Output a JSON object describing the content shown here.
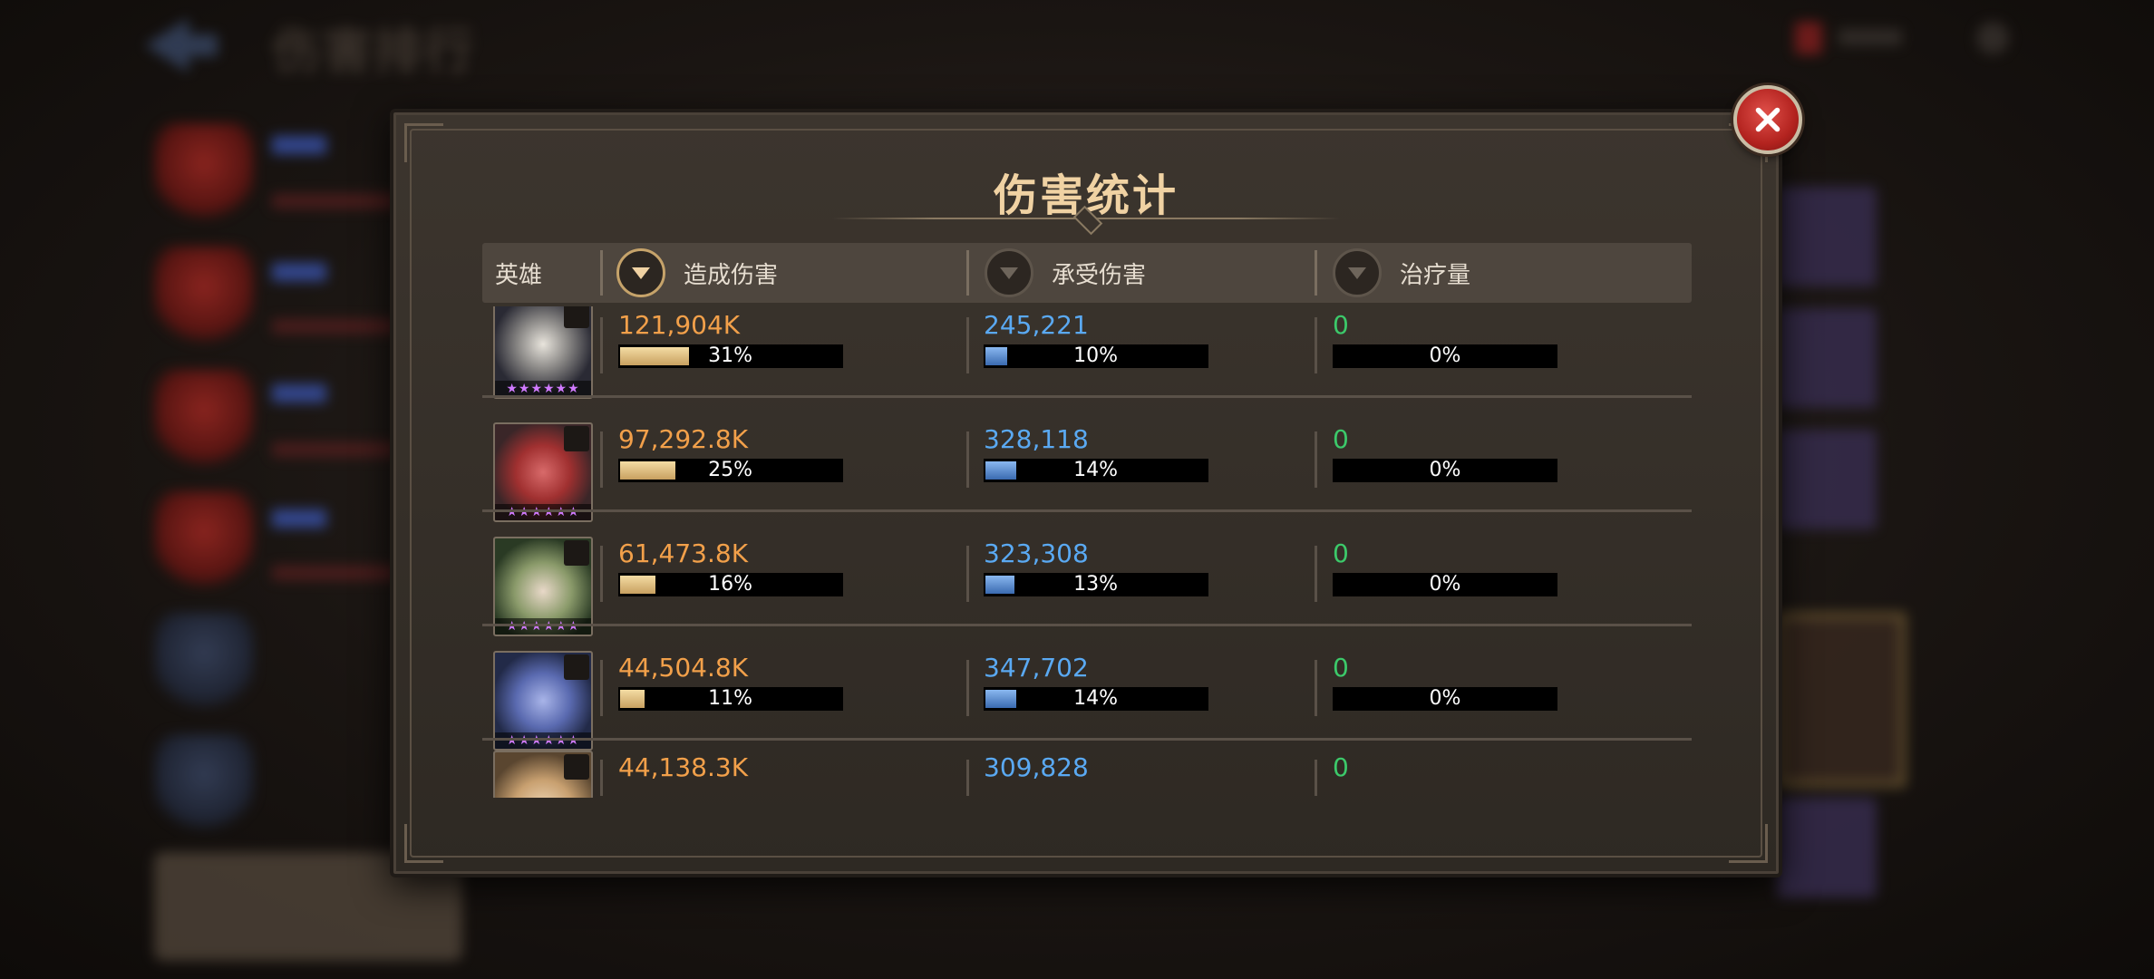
{
  "panel": {
    "title": "伤害统计"
  },
  "columns": {
    "hero": "英雄",
    "damage_dealt": "造成伤害",
    "damage_taken": "承受伤害",
    "healing": "治疗量"
  },
  "stars": "★★★★★★",
  "rows": [
    {
      "damage_dealt": "121,904K",
      "dealt_pct": "31%",
      "dealt_frac": 0.31,
      "damage_taken": "245,221",
      "taken_pct": "10%",
      "taken_frac": 0.1,
      "healing": "0",
      "heal_pct": "0%",
      "heal_frac": 0
    },
    {
      "damage_dealt": "97,292.8K",
      "dealt_pct": "25%",
      "dealt_frac": 0.25,
      "damage_taken": "328,118",
      "taken_pct": "14%",
      "taken_frac": 0.14,
      "healing": "0",
      "heal_pct": "0%",
      "heal_frac": 0
    },
    {
      "damage_dealt": "61,473.8K",
      "dealt_pct": "16%",
      "dealt_frac": 0.16,
      "damage_taken": "323,308",
      "taken_pct": "13%",
      "taken_frac": 0.13,
      "healing": "0",
      "heal_pct": "0%",
      "heal_frac": 0
    },
    {
      "damage_dealt": "44,504.8K",
      "dealt_pct": "11%",
      "dealt_frac": 0.11,
      "damage_taken": "347,702",
      "taken_pct": "14%",
      "taken_frac": 0.14,
      "healing": "0",
      "heal_pct": "0%",
      "heal_frac": 0
    },
    {
      "damage_dealt": "44,138.3K",
      "damage_taken": "309,828",
      "healing": "0"
    }
  ],
  "background": {
    "page_title": "伤害排行"
  },
  "colors": {
    "dealt": "#f2a04a",
    "taken": "#5aa9f2",
    "healing": "#3cc96a",
    "title": "#f0d2a3",
    "close": "#c9302c"
  }
}
